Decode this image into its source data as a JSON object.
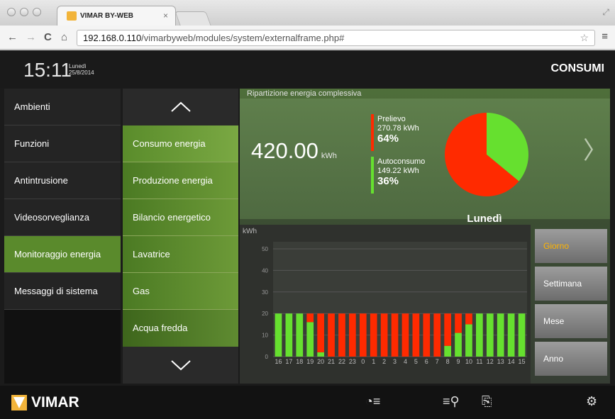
{
  "browser": {
    "tab_title": "VIMAR BY-WEB",
    "tab_close": "×",
    "url_host": "192.168.0.110",
    "url_path": "/vimarbyweb/modules/system/externalframe.php#"
  },
  "header": {
    "time": "15:11",
    "day": "Lunedì",
    "date": "25/8/2014",
    "section": "CONSUMI"
  },
  "leftnav": {
    "items": [
      {
        "label": "Ambienti"
      },
      {
        "label": "Funzioni"
      },
      {
        "label": "Antintrusione"
      },
      {
        "label": "Videosorveglianza"
      },
      {
        "label": "Monitoraggio energia"
      },
      {
        "label": "Messaggi di sistema"
      }
    ]
  },
  "subnav": {
    "items": [
      {
        "label": "Consumo energia"
      },
      {
        "label": "Produzione energia"
      },
      {
        "label": "Bilancio energetico"
      },
      {
        "label": "Lavatrice"
      },
      {
        "label": "Gas"
      },
      {
        "label": "Acqua fredda"
      }
    ]
  },
  "summary": {
    "title": "Ripartizione energia complessiva",
    "total": "420.00",
    "total_unit": "kWh",
    "prelievo": {
      "label": "Prelievo",
      "value": "270.78 kWh",
      "percent": "64%"
    },
    "autoconsumo": {
      "label": "Autoconsumo",
      "value": "149.22 kWh",
      "percent": "36%"
    },
    "colors": {
      "prelievo": "#ff2a00",
      "autoconsumo": "#66e02f"
    },
    "pie_fractions": {
      "prelievo": 0.64,
      "autoconsumo": 0.36
    }
  },
  "day_label": "Lunedì",
  "periods": {
    "giorno": "Giorno",
    "settimana": "Settimana",
    "mese": "Mese",
    "anno": "Anno"
  },
  "chart_data": {
    "type": "bar",
    "ylabel": "kWh",
    "ylim": [
      0,
      50
    ],
    "yticks": [
      0,
      10,
      20,
      30,
      40,
      50
    ],
    "categories": [
      "16",
      "17",
      "18",
      "19",
      "20",
      "21",
      "22",
      "23",
      "0",
      "1",
      "2",
      "3",
      "4",
      "5",
      "6",
      "7",
      "8",
      "9",
      "10",
      "11",
      "12",
      "13",
      "14",
      "15"
    ],
    "series": [
      {
        "name": "Autoconsumo",
        "color": "#66e02f",
        "values": [
          20,
          20,
          20,
          16,
          2,
          0,
          0,
          0,
          0,
          0,
          0,
          0,
          0,
          0,
          0,
          0,
          5,
          11,
          15,
          20,
          20,
          20,
          20,
          20
        ]
      },
      {
        "name": "Prelievo",
        "color": "#ff2a00",
        "values": [
          0,
          0,
          0,
          4,
          18,
          20,
          20,
          20,
          20,
          20,
          20,
          20,
          20,
          20,
          20,
          20,
          15,
          9,
          5,
          0,
          0,
          0,
          0,
          0
        ]
      }
    ],
    "grid": true,
    "stacked": true
  }
}
